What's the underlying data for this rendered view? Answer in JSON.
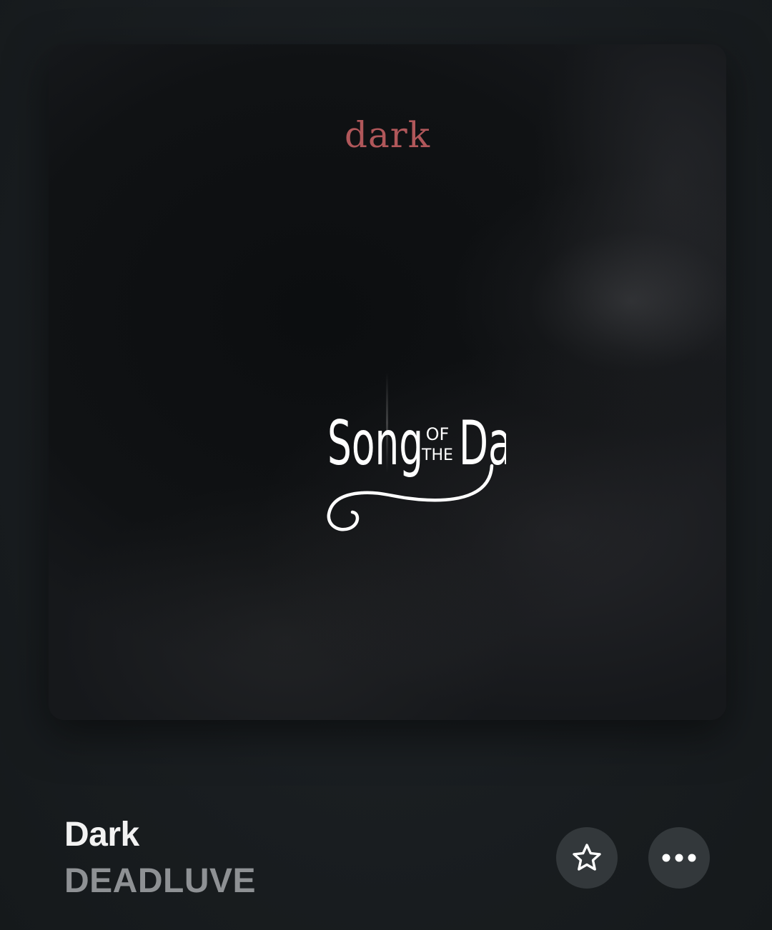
{
  "artwork": {
    "title_text": "dark",
    "overlay_logo": {
      "word1": "Song",
      "small_top": "OF",
      "small_bottom": "THE",
      "word2": "Day"
    }
  },
  "track": {
    "title": "Dark",
    "artist": "DEADLUVE"
  },
  "actions": {
    "favorite_icon": "star-icon",
    "more_icon": "ellipsis-icon"
  },
  "colors": {
    "background": "#191d20",
    "artwork_title": "#b0575a",
    "button_bg": "#33383b",
    "title_text": "#f2f2f2",
    "artist_text": "#8e9194"
  }
}
